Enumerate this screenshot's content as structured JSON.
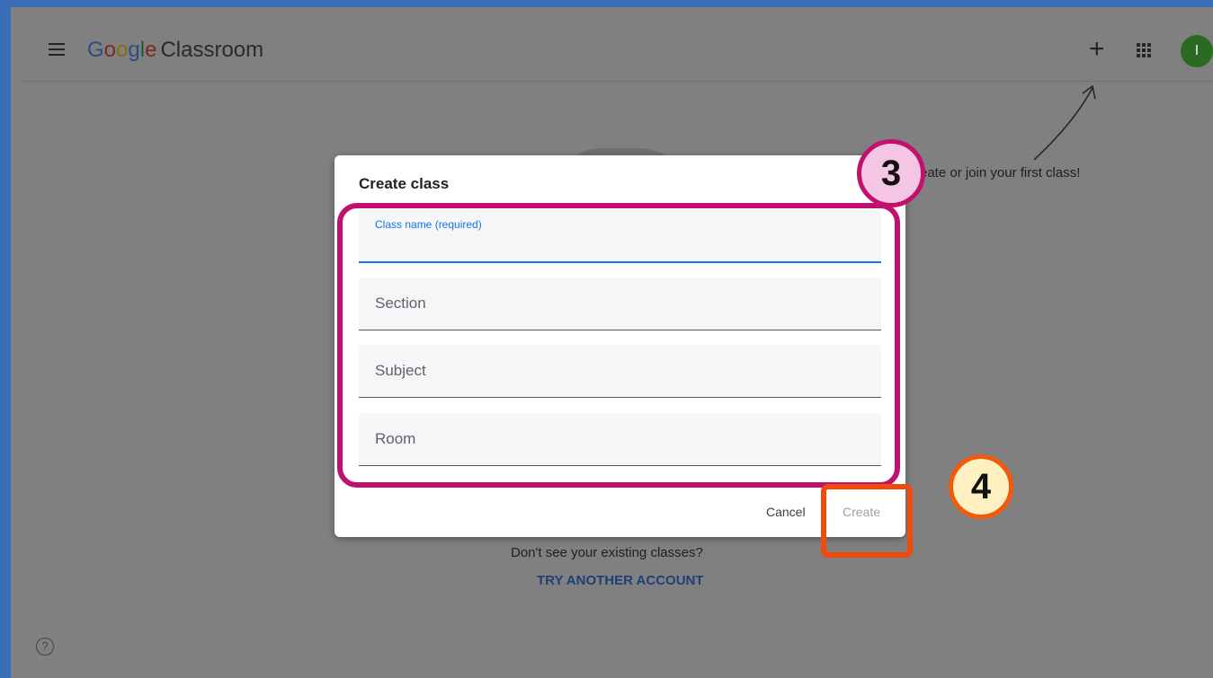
{
  "header": {
    "logo_google": [
      "G",
      "o",
      "o",
      "g",
      "l",
      "e"
    ],
    "logo_product": "Classroom",
    "avatar_initial": "I"
  },
  "background": {
    "hint": "eate or join your first class!",
    "existing_text": "Don't see your existing classes?",
    "try_another": "TRY ANOTHER ACCOUNT"
  },
  "dialog": {
    "title": "Create class",
    "fields": [
      {
        "label": "Class name (required)",
        "value": ""
      },
      {
        "placeholder": "Section"
      },
      {
        "placeholder": "Subject"
      },
      {
        "placeholder": "Room"
      }
    ],
    "cancel": "Cancel",
    "create": "Create"
  },
  "annotations": {
    "step3": "3",
    "step4": "4",
    "colors": {
      "step3": "#c2106e",
      "step4": "#f24a0a"
    }
  },
  "icons": [
    "menu-icon",
    "plus-icon",
    "apps-grid-icon",
    "help-icon",
    "arrow-icon"
  ]
}
